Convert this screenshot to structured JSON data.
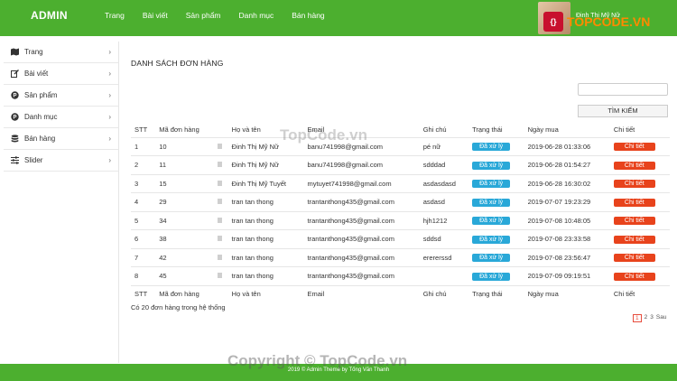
{
  "header": {
    "brand": "ADMIN",
    "nav": [
      "Trang",
      "Bài viết",
      "Sản phẩm",
      "Danh mục",
      "Bán hàng"
    ],
    "user_name": "Đinh Thị Mỹ Nữ"
  },
  "sidebar": {
    "items": [
      {
        "label": "Trang",
        "icon": "map-icon"
      },
      {
        "label": "Bài viết",
        "icon": "edit-icon"
      },
      {
        "label": "Sản phẩm",
        "icon": "product-icon"
      },
      {
        "label": "Danh mục",
        "icon": "category-icon"
      },
      {
        "label": "Bán hàng",
        "icon": "database-icon"
      },
      {
        "label": "Slider",
        "icon": "sliders-icon"
      }
    ]
  },
  "main": {
    "title": "DANH SÁCH ĐƠN HÀNG",
    "search_placeholder": "",
    "search_button": "TÌM KIẾM",
    "columns": [
      "STT",
      "Mã đơn hàng",
      "",
      "Họ và tên",
      "Email",
      "Ghi chú",
      "Trạng thái",
      "Ngày mua",
      "Chi tiết"
    ],
    "rows": [
      {
        "stt": "1",
        "id": "10",
        "name": "Đinh Thị Mỹ Nữ",
        "email": "banu741998@gmail.com",
        "note": "pé nữ",
        "status": "Đã xử lý",
        "date": "2019-06-28 01:33:06",
        "detail": "Chi tiết"
      },
      {
        "stt": "2",
        "id": "11",
        "name": "Đinh Thị Mỹ Nữ",
        "email": "banu741998@gmail.com",
        "note": "sdddad",
        "status": "Đã xử lý",
        "date": "2019-06-28 01:54:27",
        "detail": "Chi tiết"
      },
      {
        "stt": "3",
        "id": "15",
        "name": "Đinh Thị Mỹ Tuyết",
        "email": "mytuyet741998@gmail.com",
        "note": "asdasdasd",
        "status": "Đã xử lý",
        "date": "2019-06-28 16:30:02",
        "detail": "Chi tiết"
      },
      {
        "stt": "4",
        "id": "29",
        "name": "tran tan thong",
        "email": "trantanthong435@gmail.com",
        "note": "asdasd",
        "status": "Đã xử lý",
        "date": "2019-07-07 19:23:29",
        "detail": "Chi tiết"
      },
      {
        "stt": "5",
        "id": "34",
        "name": "tran tan thong",
        "email": "trantanthong435@gmail.com",
        "note": "hjh1212",
        "status": "Đã xử lý",
        "date": "2019-07-08 10:48:05",
        "detail": "Chi tiết"
      },
      {
        "stt": "6",
        "id": "38",
        "name": "tran tan thong",
        "email": "trantanthong435@gmail.com",
        "note": "sddsd",
        "status": "Đã xử lý",
        "date": "2019-07-08 23:33:58",
        "detail": "Chi tiết"
      },
      {
        "stt": "7",
        "id": "42",
        "name": "tran tan thong",
        "email": "trantanthong435@gmail.com",
        "note": "erererssd",
        "status": "Đã xử lý",
        "date": "2019-07-08 23:56:47",
        "detail": "Chi tiết"
      },
      {
        "stt": "8",
        "id": "45",
        "name": "tran tan thong",
        "email": "trantanthong435@gmail.com",
        "note": "",
        "status": "Đã xử lý",
        "date": "2019-07-09 09:19:51",
        "detail": "Chi tiết"
      }
    ],
    "summary": "Có 20 đơn hàng trong hệ thống",
    "pagination": [
      "1",
      "2",
      "3",
      "Sau"
    ]
  },
  "footer": {
    "text": "2019 © Admin Theme by Tống Văn Thanh"
  },
  "watermark": {
    "center": "TopCode.vn",
    "bottom": "Copyright © TopCode.vn",
    "logo_text": "TOPCODE.VN"
  },
  "colors": {
    "brand_green": "#4caf2f",
    "status_blue": "#29a8d8",
    "detail_red": "#e8431c"
  }
}
